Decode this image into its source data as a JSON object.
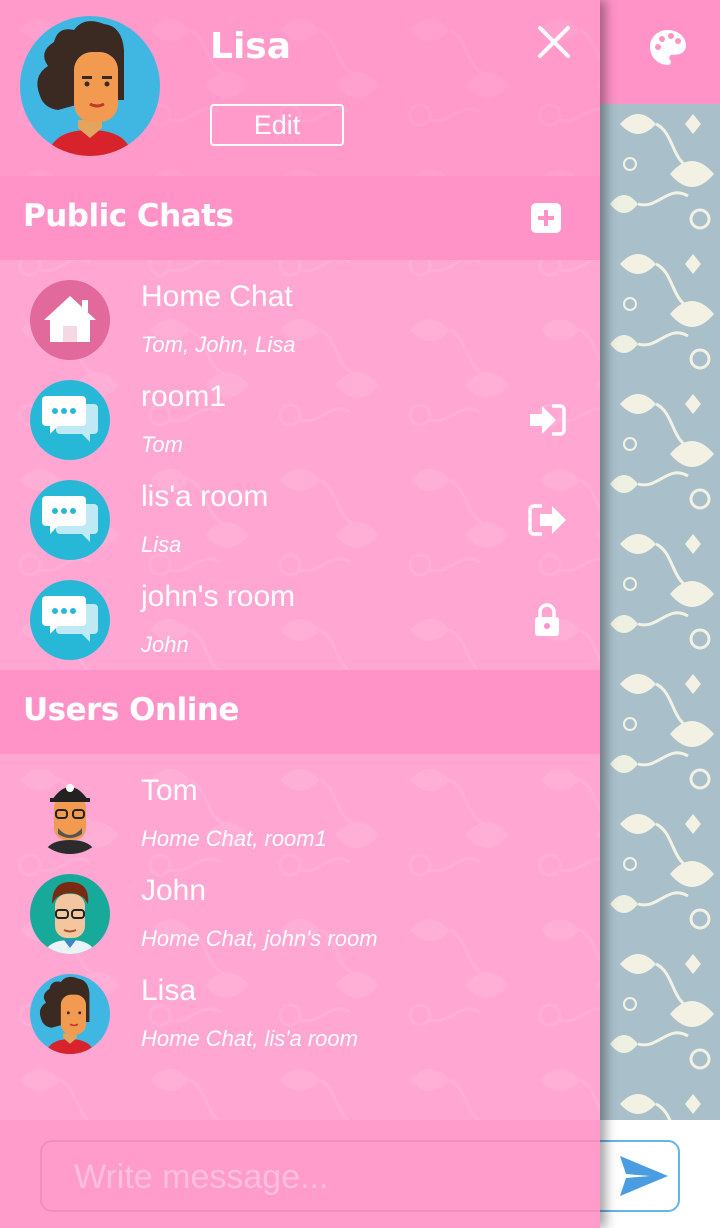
{
  "background": {
    "room_title": "lis'a room",
    "room_members": "Lisa",
    "palette_icon": "palette-icon",
    "composer_placeholder": "Write message...",
    "send_icon": "send-icon"
  },
  "colors": {
    "drawer_pink": "#ff93c8",
    "chat_bubble_blue": "#27b8d8",
    "home_pink": "#e2699b",
    "input_border": "#67b4e6"
  },
  "profile": {
    "name": "Lisa",
    "edit_label": "Edit",
    "close_icon": "close-icon"
  },
  "public_chats": {
    "title": "Public Chats",
    "add_icon": "plus-square-icon",
    "rooms": [
      {
        "name": "Home Chat",
        "members": "Tom, John, Lisa",
        "icon": "home-icon",
        "action": ""
      },
      {
        "name": "room1",
        "members": "Tom",
        "icon": "chat-bubbles-icon",
        "action": "sign-in-icon"
      },
      {
        "name": "lis'a room",
        "members": "Lisa",
        "icon": "chat-bubbles-icon",
        "action": "sign-out-icon"
      },
      {
        "name": "john's room",
        "members": "John",
        "icon": "chat-bubbles-icon",
        "action": "lock-icon"
      }
    ]
  },
  "users_online": {
    "title": "Users Online",
    "users": [
      {
        "name": "Tom",
        "rooms": "Home Chat, room1"
      },
      {
        "name": "John",
        "rooms": "Home Chat, john's room"
      },
      {
        "name": "Lisa",
        "rooms": "Home Chat, lis'a room"
      }
    ]
  }
}
